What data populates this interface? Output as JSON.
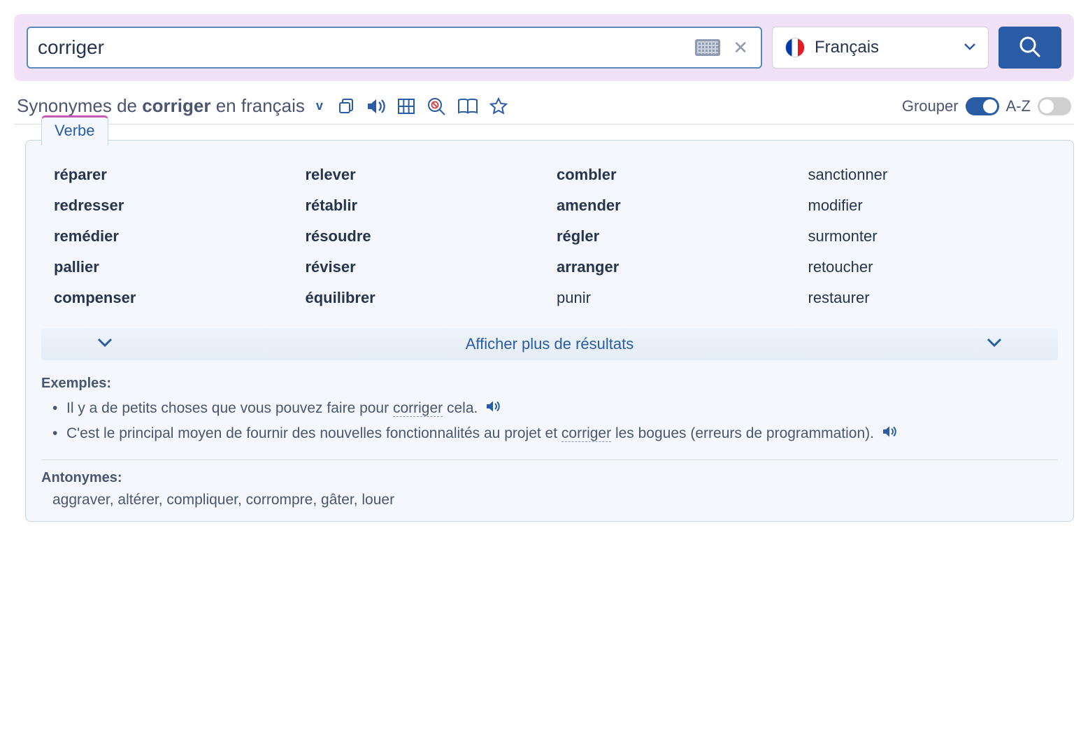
{
  "search": {
    "value": "corriger"
  },
  "language": {
    "label": "Français"
  },
  "header": {
    "prefix": "Synonymes de ",
    "word": "corriger",
    "suffix": " en français",
    "pos": "v",
    "group_label": "Grouper",
    "az_label": "A-Z"
  },
  "tab": {
    "label": "Verbe"
  },
  "synonyms": [
    {
      "w": "réparer",
      "bold": true
    },
    {
      "w": "redresser",
      "bold": true
    },
    {
      "w": "remédier",
      "bold": true
    },
    {
      "w": "pallier",
      "bold": true
    },
    {
      "w": "compenser",
      "bold": true
    },
    {
      "w": "relever",
      "bold": true
    },
    {
      "w": "rétablir",
      "bold": true
    },
    {
      "w": "résoudre",
      "bold": true
    },
    {
      "w": "réviser",
      "bold": true
    },
    {
      "w": "équilibrer",
      "bold": true
    },
    {
      "w": "combler",
      "bold": true
    },
    {
      "w": "amender",
      "bold": true
    },
    {
      "w": "régler",
      "bold": true
    },
    {
      "w": "arranger",
      "bold": true
    },
    {
      "w": "punir",
      "bold": false
    },
    {
      "w": "sanctionner",
      "bold": false
    },
    {
      "w": "modifier",
      "bold": false
    },
    {
      "w": "surmonter",
      "bold": false
    },
    {
      "w": "retoucher",
      "bold": false
    },
    {
      "w": "restaurer",
      "bold": false
    }
  ],
  "more": {
    "label": "Afficher plus de résultats"
  },
  "examples": {
    "title": "Exemples:",
    "items": [
      {
        "pre": "Il y a de petits choses que vous pouvez faire pour ",
        "hl": "corriger",
        "post": " cela."
      },
      {
        "pre": "C'est le principal moyen de fournir des nouvelles fonctionnalités au projet et ",
        "hl": "corriger",
        "post": " les bogues (erreurs de programmation)."
      }
    ]
  },
  "antonyms": {
    "title": "Antonymes:",
    "list": "aggraver, altérer, compliquer, corrompre, gâter, louer"
  }
}
